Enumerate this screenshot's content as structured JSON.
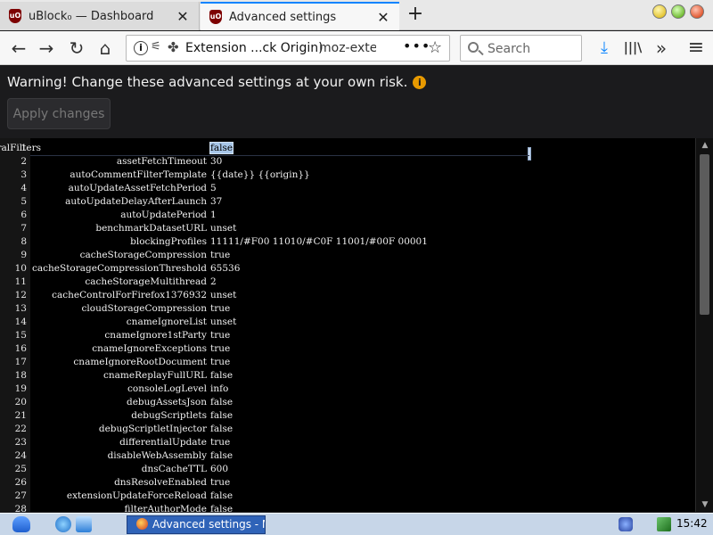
{
  "tabs": [
    {
      "title": "uBlock₀ — Dashboard",
      "close": "✕"
    },
    {
      "title": "Advanced settings",
      "close": "✕"
    }
  ],
  "newtab": "+",
  "nav": {
    "back": "←",
    "forward": "→",
    "reload": "↻",
    "home": "⌂"
  },
  "urlbar": {
    "info": "i",
    "ext_label": "Extension ...ck Origin)",
    "url": "moz-extension://",
    "more": "•••",
    "star": "☆"
  },
  "search": {
    "placeholder": "Search"
  },
  "toolbar": {
    "download": "⤓",
    "library": "|||\\",
    "overflow": "»",
    "menu": "≡"
  },
  "warning": {
    "text": "Warning! Change these advanced settings at your own risk.",
    "icon": "i"
  },
  "apply_label": "Apply changes",
  "settings": [
    {
      "n": "1",
      "key": "allowGenericProceduralFilters",
      "value": "false"
    },
    {
      "n": "2",
      "key": "assetFetchTimeout",
      "value": "30"
    },
    {
      "n": "3",
      "key": "autoCommentFilterTemplate",
      "value": "{{date}} {{origin}}"
    },
    {
      "n": "4",
      "key": "autoUpdateAssetFetchPeriod",
      "value": "5"
    },
    {
      "n": "5",
      "key": "autoUpdateDelayAfterLaunch",
      "value": "37"
    },
    {
      "n": "6",
      "key": "autoUpdatePeriod",
      "value": "1"
    },
    {
      "n": "7",
      "key": "benchmarkDatasetURL",
      "value": "unset"
    },
    {
      "n": "8",
      "key": "blockingProfiles",
      "value": "11111/#F00 11010/#C0F 11001/#00F 00001"
    },
    {
      "n": "9",
      "key": "cacheStorageCompression",
      "value": "true"
    },
    {
      "n": "10",
      "key": "cacheStorageCompressionThreshold",
      "value": "65536"
    },
    {
      "n": "11",
      "key": "cacheStorageMultithread",
      "value": "2"
    },
    {
      "n": "12",
      "key": "cacheControlForFirefox1376932",
      "value": "unset"
    },
    {
      "n": "13",
      "key": "cloudStorageCompression",
      "value": "true"
    },
    {
      "n": "14",
      "key": "cnameIgnoreList",
      "value": "unset"
    },
    {
      "n": "15",
      "key": "cnameIgnore1stParty",
      "value": "true"
    },
    {
      "n": "16",
      "key": "cnameIgnoreExceptions",
      "value": "true"
    },
    {
      "n": "17",
      "key": "cnameIgnoreRootDocument",
      "value": "true"
    },
    {
      "n": "18",
      "key": "cnameReplayFullURL",
      "value": "false"
    },
    {
      "n": "19",
      "key": "consoleLogLevel",
      "value": "info"
    },
    {
      "n": "20",
      "key": "debugAssetsJson",
      "value": "false"
    },
    {
      "n": "21",
      "key": "debugScriptlets",
      "value": "false"
    },
    {
      "n": "22",
      "key": "debugScriptletInjector",
      "value": "false"
    },
    {
      "n": "23",
      "key": "differentialUpdate",
      "value": "true"
    },
    {
      "n": "24",
      "key": "disableWebAssembly",
      "value": "false"
    },
    {
      "n": "25",
      "key": "dnsCacheTTL",
      "value": "600"
    },
    {
      "n": "26",
      "key": "dnsResolveEnabled",
      "value": "true"
    },
    {
      "n": "27",
      "key": "extensionUpdateForceReload",
      "value": "false"
    },
    {
      "n": "28",
      "key": "filterAuthorMode",
      "value": "false"
    }
  ],
  "scroll": {
    "up": "▲",
    "down": "▼"
  },
  "taskbar": {
    "task_label": "Advanced settings - M...",
    "clock": "15:42"
  }
}
